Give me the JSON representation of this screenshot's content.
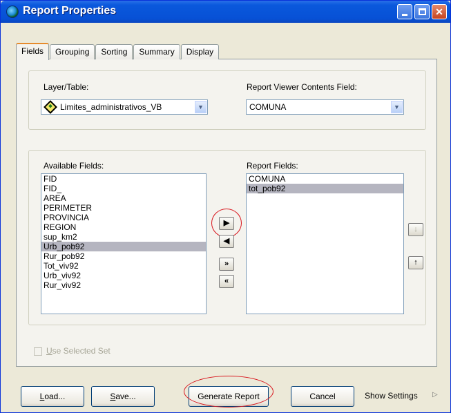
{
  "window": {
    "title": "Report Properties",
    "title_icon": "globe-icon",
    "controls": [
      "minimize",
      "maximize",
      "close"
    ]
  },
  "tabs": [
    "Fields",
    "Grouping",
    "Sorting",
    "Summary",
    "Display"
  ],
  "active_tab": "Fields",
  "layer": {
    "label": "Layer/Table:",
    "value": "Limites_administrativos_VB",
    "icon": "layer-icon"
  },
  "contents_field": {
    "label": "Report Viewer Contents Field:",
    "value": "COMUNA"
  },
  "available": {
    "label": "Available Fields:",
    "items": [
      "FID",
      "FID_",
      "AREA",
      "PERIMETER",
      "PROVINCIA",
      "REGION",
      "sup_km2",
      "Urb_pob92",
      "Rur_pob92",
      "Tot_viv92",
      "Urb_viv92",
      "Rur_viv92"
    ],
    "selected": "Urb_pob92"
  },
  "report": {
    "label": "Report Fields:",
    "items": [
      "COMUNA",
      "tot_pob92"
    ],
    "selected": "tot_pob92"
  },
  "move_buttons": {
    "add": "▶",
    "remove": "◀",
    "add_all": "»",
    "remove_all": "«"
  },
  "order_buttons": {
    "up": "↓",
    "down": "↑"
  },
  "use_selected_set": {
    "label": "Use Selected Set",
    "checked": false
  },
  "buttons": {
    "load": "Load...",
    "save": "Save...",
    "generate": "Generate Report",
    "cancel": "Cancel"
  },
  "show_settings": {
    "label": "Show Settings",
    "arrow": "▷"
  },
  "colors": {
    "title_bar": "#0a58dc",
    "highlight_circle": "#d8141c",
    "selection": "#b5b5c0"
  }
}
